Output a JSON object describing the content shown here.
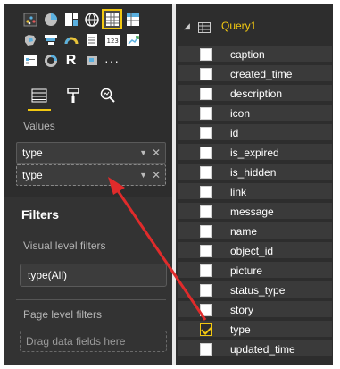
{
  "visualizations_pane": {
    "icons_row1": [
      "scatter-chart-icon",
      "pie-chart-icon",
      "treemap-icon",
      "globe-map-icon",
      "table-icon",
      "matrix-icon"
    ],
    "icons_row2": [
      "filled-map-icon",
      "funnel-icon",
      "gauge-icon",
      "multirow-card-icon",
      "card-icon",
      "kpi-icon"
    ],
    "icons_row3": [
      "slicer-icon",
      "donut-icon",
      "r-visual-icon",
      "shape-map-icon",
      "more-options-icon"
    ],
    "r_letter": "R",
    "more": "···",
    "tabs": [
      "fields-tab",
      "format-tab",
      "analytics-tab"
    ]
  },
  "values": {
    "label": "Values",
    "fields": [
      {
        "label": "type"
      },
      {
        "label": "type"
      }
    ]
  },
  "filters": {
    "title": "Filters",
    "visual_level_label": "Visual level filters",
    "visual_filter_chip": "type(All)",
    "page_level_label": "Page level filters",
    "drop_placeholder": "Drag data fields here"
  },
  "fields_pane": {
    "query_title": "Query1",
    "fields": [
      {
        "label": "caption",
        "checked": false
      },
      {
        "label": "created_time",
        "checked": false
      },
      {
        "label": "description",
        "checked": false
      },
      {
        "label": "icon",
        "checked": false
      },
      {
        "label": "id",
        "checked": false
      },
      {
        "label": "is_expired",
        "checked": false
      },
      {
        "label": "is_hidden",
        "checked": false
      },
      {
        "label": "link",
        "checked": false
      },
      {
        "label": "message",
        "checked": false
      },
      {
        "label": "name",
        "checked": false
      },
      {
        "label": "object_id",
        "checked": false
      },
      {
        "label": "picture",
        "checked": false
      },
      {
        "label": "status_type",
        "checked": false
      },
      {
        "label": "story",
        "checked": false
      },
      {
        "label": "type",
        "checked": true
      },
      {
        "label": "updated_time",
        "checked": false
      }
    ]
  },
  "colors": {
    "accent": "#f2c811",
    "pane_bg": "#2d2d2d",
    "annotation_arrow": "#e02b2b"
  }
}
